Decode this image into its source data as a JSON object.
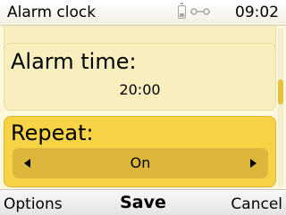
{
  "statusbar": {
    "title": "Alarm clock",
    "time": "09:02",
    "icons": [
      "battery-icon",
      "signal-icon"
    ]
  },
  "fields": {
    "previous_value_partial": "On",
    "alarm_time": {
      "label": "Alarm time:",
      "value": "20:00"
    },
    "repeat": {
      "label": "Repeat:",
      "value": "On"
    }
  },
  "softkeys": {
    "left": "Options",
    "center": "Save",
    "right": "Cancel"
  },
  "colors": {
    "background": "#fdf8dc",
    "field_bg": "#f8eebe",
    "selected_field_bg": "#f6d245",
    "selector_bg": "#ddb63c"
  }
}
